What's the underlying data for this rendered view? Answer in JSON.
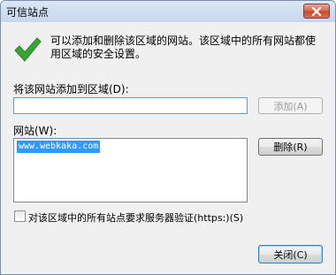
{
  "window": {
    "title": "可信站点"
  },
  "info": {
    "text": "可以添加和删除该区域的网站。该区域中的所有网站都使用区域的安全设置。"
  },
  "add_section": {
    "label": "将该网站添加到区域(D):",
    "input_value": "",
    "add_button": "添加(A)"
  },
  "sites_section": {
    "label": "网站(W):",
    "items": [
      "www.webkaka.com"
    ],
    "remove_button": "删除(R)"
  },
  "https_option": {
    "checked": false,
    "label": "对该区域中的所有站点要求服务器验证(https:)(S)"
  },
  "footer": {
    "close_button": "关闭(C)"
  },
  "colors": {
    "check_green": "#3aa536",
    "selection": "#3399ff",
    "title_bar": "#c6d7ee",
    "close_button_red": "#c44c2e"
  }
}
